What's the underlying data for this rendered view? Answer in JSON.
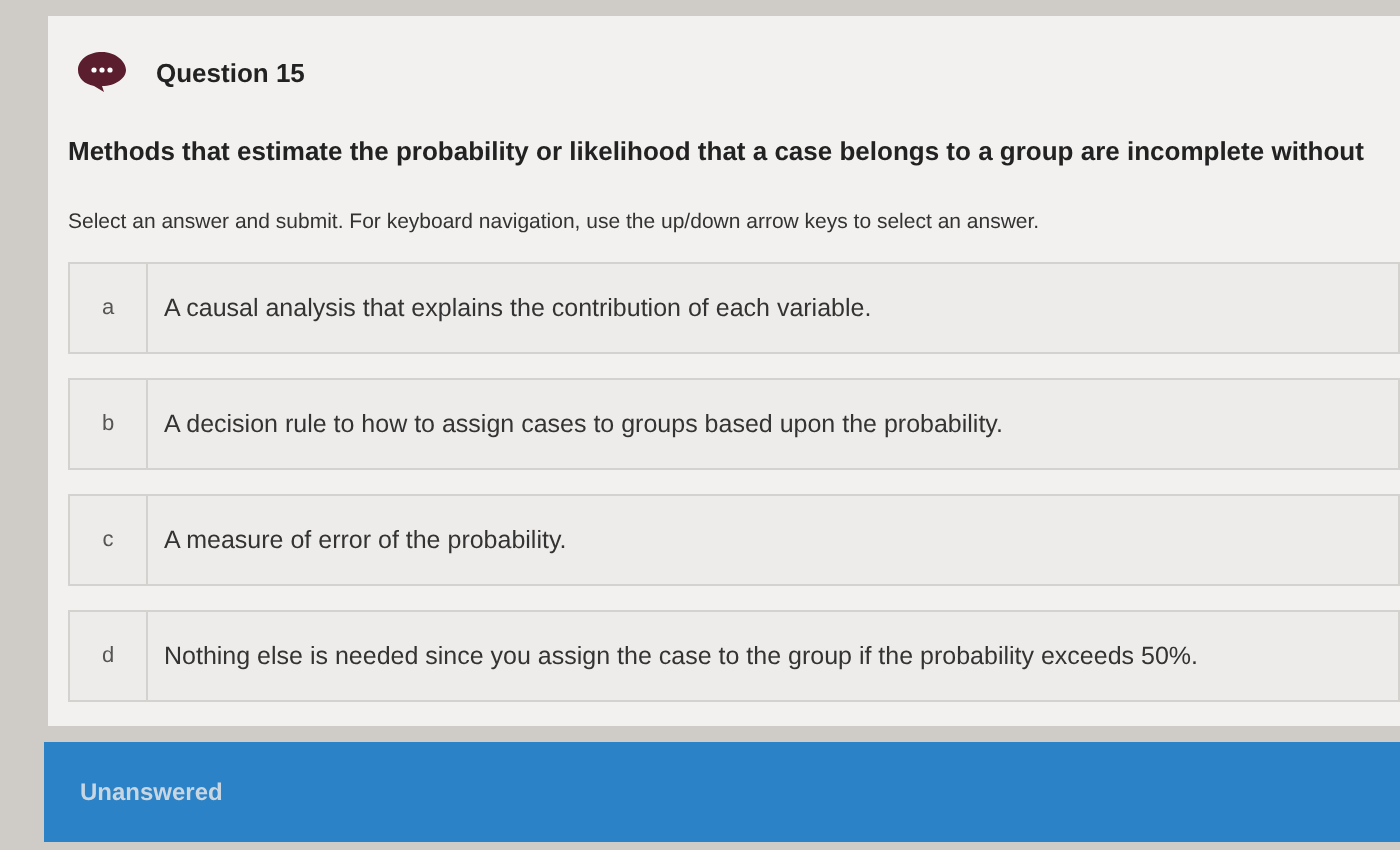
{
  "question": {
    "title": "Question 15",
    "text": "Methods that estimate the probability or likelihood that a case belongs to a group are incomplete without",
    "instruction": "Select an answer and submit. For keyboard navigation, use the up/down arrow keys to select an answer."
  },
  "options": [
    {
      "letter": "a",
      "text": "A causal analysis that explains the contribution of each variable.",
      "selected": false
    },
    {
      "letter": "b",
      "text": "A decision rule to how to assign cases to groups based upon the probability.",
      "selected": false
    },
    {
      "letter": "c",
      "text": "A measure of error of the probability.",
      "selected": false
    },
    {
      "letter": "d",
      "text": "Nothing else is needed since you assign the case to the group if the probability exceeds 50%.",
      "selected": false
    }
  ],
  "status_bar": {
    "text": "Unanswered"
  }
}
